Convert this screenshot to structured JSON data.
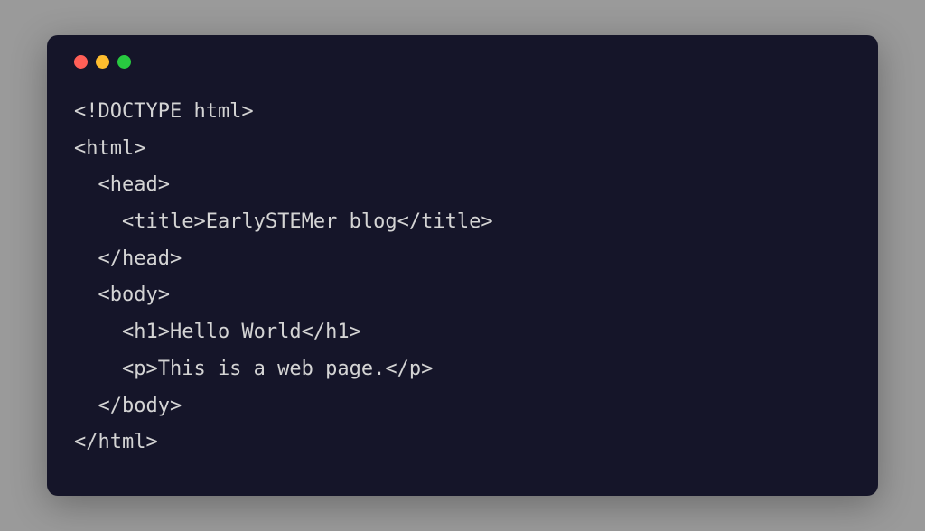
{
  "window": {
    "controls": {
      "close": "close",
      "minimize": "minimize",
      "maximize": "maximize"
    }
  },
  "code": {
    "lines": [
      "<!DOCTYPE html>",
      "<html>",
      "  <head>",
      "    <title>EarlySTEMer blog</title>",
      "  </head>",
      "  <body>",
      "    <h1>Hello World</h1>",
      "    <p>This is a web page.</p>",
      "  </body>",
      "</html>"
    ]
  }
}
